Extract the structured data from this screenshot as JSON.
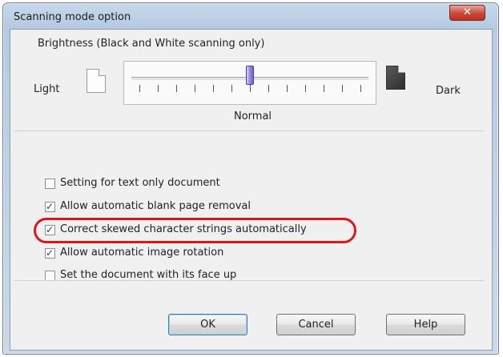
{
  "window": {
    "title": "Scanning mode option",
    "close_icon": "x-icon"
  },
  "brightness": {
    "label": "Brightness (Black and White scanning only)",
    "light_label": "Light",
    "dark_label": "Dark",
    "normal_label": "Normal",
    "level": 0.5,
    "tick_count": 13,
    "light_icon": "blank-page-icon",
    "dark_icon": "dark-page-icon"
  },
  "options": [
    {
      "label": "Setting for text only document",
      "checked": false
    },
    {
      "label": "Allow automatic blank page removal",
      "checked": true
    },
    {
      "label": "Correct skewed character strings automatically",
      "checked": true,
      "highlighted": true
    },
    {
      "label": "Allow automatic image rotation",
      "checked": true
    },
    {
      "label": "Set the document with its face up",
      "checked": false
    }
  ],
  "buttons": {
    "ok": "OK",
    "cancel": "Cancel",
    "help": "Help"
  },
  "colors": {
    "highlight": "#e1141c",
    "thumb": "#8d84e0"
  }
}
